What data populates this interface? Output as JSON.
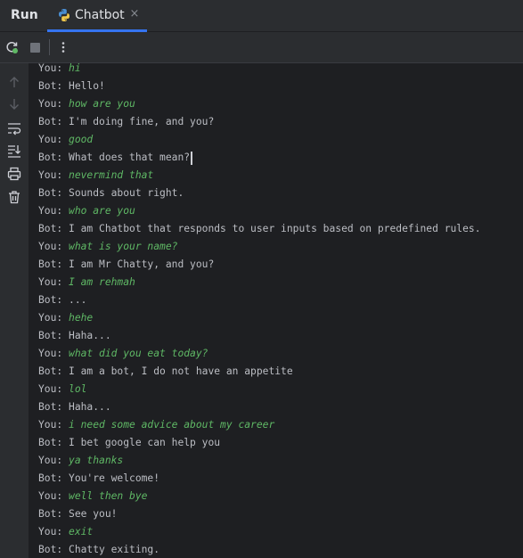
{
  "tabbar": {
    "run_label": "Run",
    "tab_label": "Chatbot",
    "close_glyph": "×"
  },
  "toolbar": {
    "rerun_icon": "rerun-icon",
    "stop_icon": "stop-icon",
    "more_icon": "more-vertical-icon"
  },
  "sidebar": {
    "icons": [
      "arrow-up-icon",
      "arrow-down-icon",
      "soft-wrap-icon",
      "scroll-to-end-icon",
      "print-icon",
      "trash-icon"
    ]
  },
  "colors": {
    "background": "#1e1f22",
    "panel": "#2b2d30",
    "text": "#bcbec4",
    "user_input": "#5fb865",
    "tab_underline": "#3574f0"
  },
  "console": {
    "lines": [
      {
        "prefix": "You: ",
        "text": "hi",
        "user": true
      },
      {
        "prefix": "Bot: ",
        "text": "Hello!",
        "user": false
      },
      {
        "prefix": "You: ",
        "text": "how are you",
        "user": true
      },
      {
        "prefix": "Bot: ",
        "text": "I'm doing fine, and you?",
        "user": false
      },
      {
        "prefix": "You: ",
        "text": "good",
        "user": true
      },
      {
        "prefix": "Bot: ",
        "text": "What does that mean?",
        "user": false
      },
      {
        "prefix": "You: ",
        "text": "nevermind that",
        "user": true
      },
      {
        "prefix": "Bot: ",
        "text": "Sounds about right.",
        "user": false
      },
      {
        "prefix": "You: ",
        "text": "who are you",
        "user": true
      },
      {
        "prefix": "Bot: ",
        "text": "I am Chatbot that responds to user inputs based on predefined rules.",
        "user": false
      },
      {
        "prefix": "You: ",
        "text": "what is your name?",
        "user": true
      },
      {
        "prefix": "Bot: ",
        "text": "I am Mr Chatty, and you?",
        "user": false
      },
      {
        "prefix": "You: ",
        "text": "I am rehmah",
        "user": true
      },
      {
        "prefix": "Bot: ",
        "text": "...",
        "user": false
      },
      {
        "prefix": "You: ",
        "text": "hehe",
        "user": true
      },
      {
        "prefix": "Bot: ",
        "text": "Haha...",
        "user": false
      },
      {
        "prefix": "You: ",
        "text": "what did you eat today?",
        "user": true
      },
      {
        "prefix": "Bot: ",
        "text": "I am a bot, I do not have an appetite",
        "user": false
      },
      {
        "prefix": "You: ",
        "text": "lol",
        "user": true
      },
      {
        "prefix": "Bot: ",
        "text": "Haha...",
        "user": false
      },
      {
        "prefix": "You: ",
        "text": "i need some advice about my career",
        "user": true
      },
      {
        "prefix": "Bot: ",
        "text": "I bet google can help you",
        "user": false
      },
      {
        "prefix": "You: ",
        "text": "ya thanks",
        "user": true
      },
      {
        "prefix": "Bot: ",
        "text": "You're welcome!",
        "user": false
      },
      {
        "prefix": "You: ",
        "text": "well then bye",
        "user": true
      },
      {
        "prefix": "Bot: ",
        "text": "See you!",
        "user": false
      },
      {
        "prefix": "You: ",
        "text": "exit",
        "user": true
      },
      {
        "prefix": "Bot: ",
        "text": "Chatty exiting.",
        "user": false
      }
    ]
  }
}
